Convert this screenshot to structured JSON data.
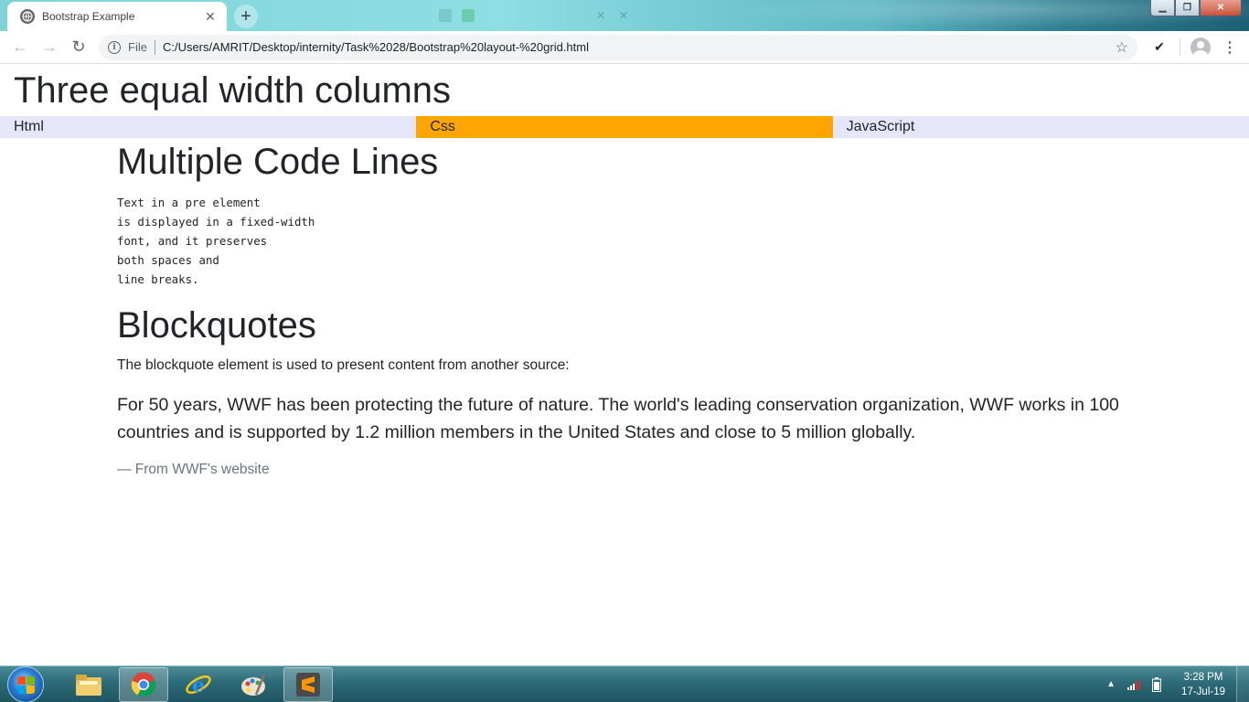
{
  "browser": {
    "active_tab": {
      "title": "Bootstrap Example",
      "close_glyph": "✕"
    },
    "new_tab_glyph": "+",
    "window_controls": {
      "minimize": "▁",
      "maximize": "❐",
      "close": "✕"
    },
    "toolbar": {
      "back_glyph": "←",
      "forward_glyph": "→",
      "reload_glyph": "↻",
      "info_glyph": "i",
      "scheme": "File",
      "url": "C:/Users/AMRIT/Desktop/internity/Task%2028/Bootstrap%20layout-%20grid.html",
      "star_glyph": "☆",
      "extension_glyph": "✔",
      "menu_glyph": "⋮"
    }
  },
  "page": {
    "title": "Three equal width columns",
    "columns": [
      {
        "label": "Html",
        "color": "#e6e6fa"
      },
      {
        "label": "Css",
        "color": "#ffa500"
      },
      {
        "label": "JavaScript",
        "color": "#e6e6fa"
      }
    ],
    "code_heading": "Multiple Code Lines",
    "pre_lines": [
      "Text in a pre element",
      "is displayed in a fixed-width",
      "font, and it preserves",
      "both spaces and",
      "line breaks."
    ],
    "blockquote_heading": "Blockquotes",
    "blockquote_intro": "The blockquote element is used to present content from another source:",
    "quote_text": "For 50 years, WWF has been protecting the future of nature. The world's leading conservation organization, WWF works in 100 countries and is supported by 1.2 million members in the United States and close to 5 million globally.",
    "quote_footer": "— From WWF's website"
  },
  "taskbar": {
    "apps": [
      "windows-explorer-icon",
      "chrome-icon",
      "internet-explorer-icon",
      "paint-icon",
      "sublime-text-icon"
    ],
    "tray_expand_glyph": "▲",
    "time": "3:28 PM",
    "date": "17-Jul-19"
  }
}
